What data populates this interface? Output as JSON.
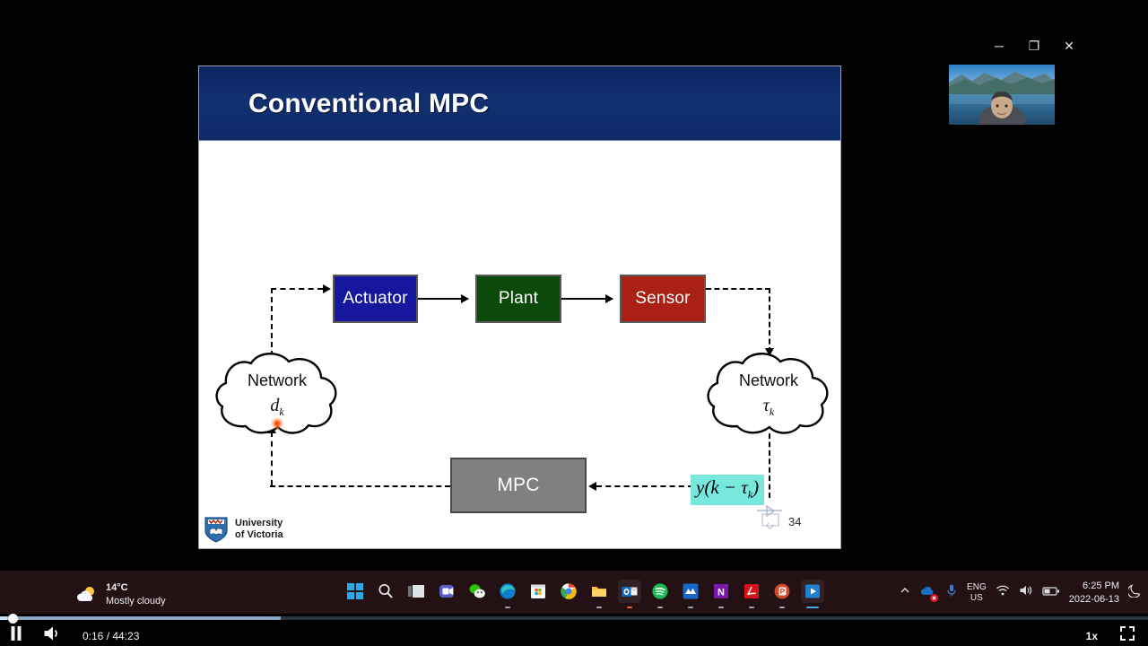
{
  "window": {
    "controls": [
      {
        "name": "minimize",
        "glyph": "─"
      },
      {
        "name": "maximize",
        "glyph": "❐"
      },
      {
        "name": "close",
        "glyph": "✕"
      }
    ]
  },
  "webcam": {
    "label": "webcam-thumbnail"
  },
  "slide": {
    "title": "Conventional MPC",
    "page_number": "34",
    "logo": {
      "line1": "University",
      "line2": "of Victoria"
    },
    "boxes": [
      {
        "id": "actuator",
        "label": "Actuator",
        "color": "#17179e"
      },
      {
        "id": "plant",
        "label": "Plant",
        "color": "#0b4a0b"
      },
      {
        "id": "sensor",
        "label": "Sensor",
        "color": "#ab2015"
      },
      {
        "id": "mpc",
        "label": "MPC",
        "color": "#808080"
      }
    ],
    "clouds": [
      {
        "id": "left",
        "label": "Network",
        "symbol": "d",
        "subscript": "k"
      },
      {
        "id": "right",
        "label": "Network",
        "symbol": "τ",
        "subscript": "k"
      }
    ],
    "formula": {
      "prefix": "y(k − τ",
      "subscript": "k",
      "suffix": ")",
      "highlight_color": "#79e8dc"
    },
    "laser_pointer": {
      "color": "#ff3a00"
    }
  },
  "taskbar": {
    "weather": {
      "temperature": "14°C",
      "condition": "Mostly cloudy"
    },
    "apps": [
      {
        "name": "start-button",
        "label": "Start"
      },
      {
        "name": "search-icon",
        "label": "Search"
      },
      {
        "name": "task-view-icon",
        "label": "Task View"
      },
      {
        "name": "teams-icon",
        "label": "Microsoft Teams"
      },
      {
        "name": "wechat-icon",
        "label": "WeChat"
      },
      {
        "name": "edge-icon",
        "label": "Microsoft Edge"
      },
      {
        "name": "store-icon",
        "label": "Microsoft Store"
      },
      {
        "name": "chrome-icon",
        "label": "Google Chrome"
      },
      {
        "name": "file-explorer-icon",
        "label": "File Explorer"
      },
      {
        "name": "outlook-icon",
        "label": "Outlook"
      },
      {
        "name": "spotify-icon",
        "label": "Spotify"
      },
      {
        "name": "atom-icon",
        "label": "App"
      },
      {
        "name": "onenote-icon",
        "label": "OneNote"
      },
      {
        "name": "acrobat-icon",
        "label": "Adobe Acrobat"
      },
      {
        "name": "powerpoint-icon",
        "label": "PowerPoint"
      },
      {
        "name": "media-player-icon",
        "label": "Media Player"
      }
    ],
    "tray": {
      "language": {
        "line1": "ENG",
        "line2": "US"
      },
      "clock": {
        "time": "6:25 PM",
        "date": "2022-06-13"
      }
    }
  },
  "player": {
    "state": "playing",
    "current_time": "0:16",
    "duration": "44:23",
    "time_label": "0:16 / 44:23",
    "speed": "1x",
    "progress_percent": 0.6,
    "buffered_percent": 24.5
  }
}
